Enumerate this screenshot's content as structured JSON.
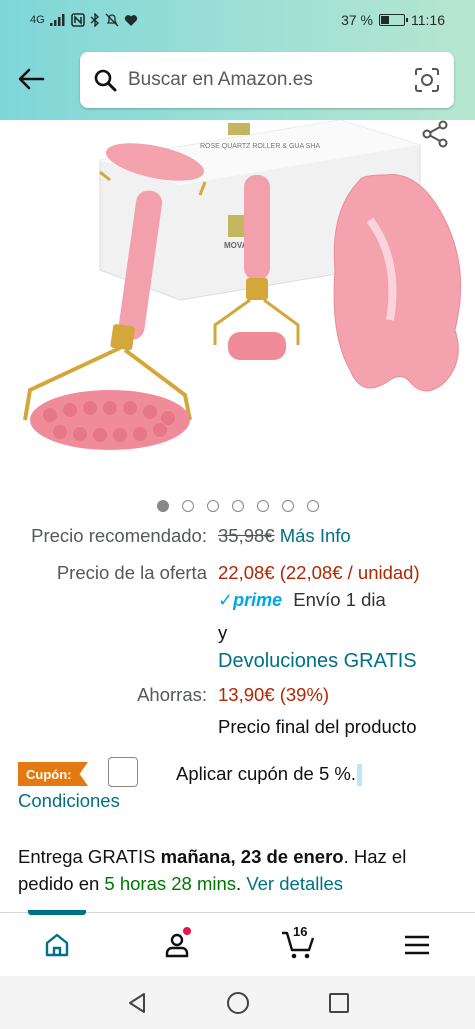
{
  "status_bar": {
    "network": "4G",
    "battery_percent": "37 %",
    "time": "11:16",
    "battery_level": 0.37
  },
  "search": {
    "placeholder": "Buscar en Amazon.es"
  },
  "product_image": {
    "brand_text": "MOVALUES",
    "box_text": "ROSE QUARTZ ROLLER & GUA SHA"
  },
  "carousel": {
    "total": 7,
    "active": 0
  },
  "prices": {
    "recommended_label": "Precio recomendado:",
    "recommended_value": "35,98€",
    "more_info": "Más Info",
    "offer_label": "Precio de la oferta",
    "offer_value": "22,08€",
    "offer_unit": "(22,08€ / unidad)",
    "prime_label": "✓prime",
    "shipping": "Envío 1 dia",
    "and": "y",
    "returns": "Devoluciones GRATIS",
    "savings_label": "Ahorras:",
    "savings_value": "13,90€ (39%)",
    "final_price_note": "Precio final del producto"
  },
  "coupon": {
    "badge": "Cupón:",
    "text": "Aplicar cupón de 5 %.",
    "conditions": "Condiciones"
  },
  "delivery": {
    "prefix": "Entrega GRATIS",
    "date": "mañana, 23 de enero",
    "middle": ". Haz el pedido en",
    "countdown": "5 horas 28 mins",
    "separator": ".",
    "details_link": "Ver detalles"
  },
  "bottom_nav": {
    "cart_count": "16"
  },
  "colors": {
    "header_gradient_start": "#7fd6d8",
    "link": "#007185",
    "price_red": "#b12704",
    "prime_blue": "#00a8e1",
    "coupon_orange": "#e47911",
    "delivery_green": "#007600"
  }
}
